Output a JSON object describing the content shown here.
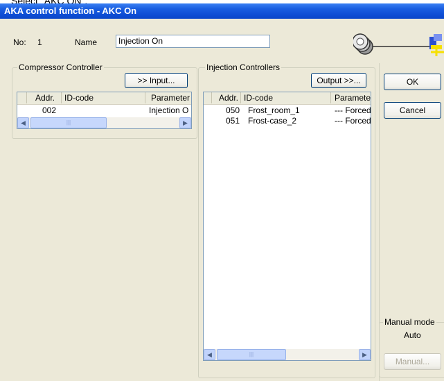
{
  "caption": "Select \"AKC ON\".",
  "window": {
    "title": "AKA control function - AKC On"
  },
  "header": {
    "no_label": "No:",
    "no_value": "1",
    "name_label": "Name",
    "name_value": "Injection On"
  },
  "compressor": {
    "group_label": "Compressor Controller",
    "input_button": ">> Input...",
    "columns": [
      "Addr.",
      "ID-code",
      "Parameter"
    ],
    "rows": [
      {
        "addr": "002",
        "id": "",
        "param": "Injection O"
      }
    ]
  },
  "injection": {
    "group_label": "Injection Controllers",
    "output_button": "Output >>...",
    "columns": [
      "Addr.",
      "ID-code",
      "Paramete"
    ],
    "rows": [
      {
        "addr": "050",
        "id": "Frost_room_1",
        "param": "--- Forced"
      },
      {
        "addr": "051",
        "id": "Frost-case_2",
        "param": "--- Forced"
      }
    ]
  },
  "buttons": {
    "ok": "OK",
    "cancel": "Cancel",
    "manual": "Manual..."
  },
  "manual_mode": {
    "label": "Manual mode",
    "value": "Auto"
  },
  "icons": {
    "connection": "network-connection-icon"
  },
  "colors": {
    "title_blue": "#0a46c8",
    "window_bg": "#ece9d8"
  }
}
